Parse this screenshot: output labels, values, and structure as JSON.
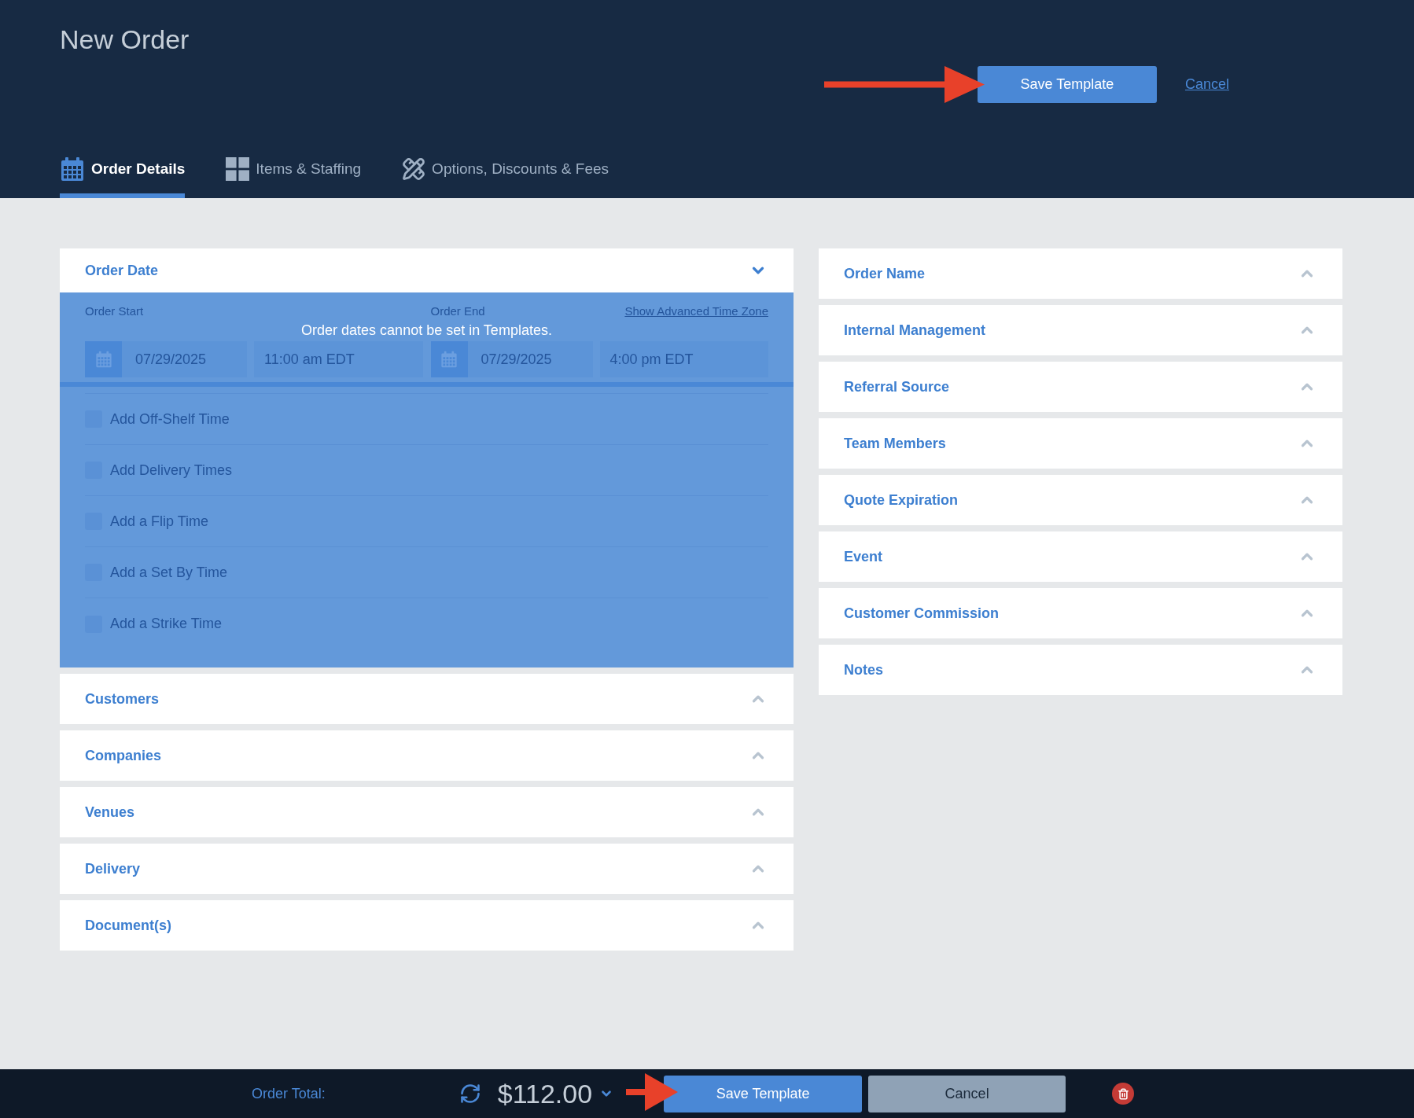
{
  "header": {
    "title": "New Order",
    "save_button": "Save Template",
    "cancel_link": "Cancel"
  },
  "tabs": [
    {
      "label": "Order Details",
      "selected": true
    },
    {
      "label": "Items & Staffing",
      "selected": false
    },
    {
      "label": "Options, Discounts & Fees",
      "selected": false
    }
  ],
  "order_date": {
    "title": "Order Date",
    "expanded": true,
    "disabled": true,
    "locked_message": "Order dates cannot be set in Templates.",
    "start": {
      "label": "Order Start",
      "date": "07/29/2025",
      "time": "11:00 am EDT"
    },
    "end": {
      "label": "Order End",
      "date": "07/29/2025",
      "time": "4:00 pm EDT"
    },
    "time_zone_link": "Show Advanced Time Zone",
    "options": [
      {
        "label": "Add Off-Shelf Time",
        "checked": false
      },
      {
        "label": "Add Delivery Times",
        "checked": false
      },
      {
        "label": "Add a Flip Time",
        "checked": false
      },
      {
        "label": "Add a Set By Time",
        "checked": false
      },
      {
        "label": "Add a Strike Time",
        "checked": false
      }
    ]
  },
  "left_sections": [
    {
      "title": "Customers",
      "expanded": false
    },
    {
      "title": "Companies",
      "expanded": false
    },
    {
      "title": "Venues",
      "expanded": false
    },
    {
      "title": "Delivery",
      "expanded": false
    },
    {
      "title": "Document(s)",
      "expanded": false
    }
  ],
  "right_sections": [
    {
      "title": "Order Name",
      "expanded": false
    },
    {
      "title": "Internal Management",
      "expanded": false
    },
    {
      "title": "Referral Source",
      "expanded": false
    },
    {
      "title": "Team Members",
      "expanded": false
    },
    {
      "title": "Quote Expiration",
      "expanded": false
    },
    {
      "title": "Event",
      "expanded": false
    },
    {
      "title": "Customer Commission",
      "expanded": false
    },
    {
      "title": "Notes",
      "expanded": false
    }
  ],
  "footer": {
    "total_label": "Order Total:",
    "total": "$112.00",
    "save_button": "Save Template",
    "cancel_button": "Cancel"
  }
}
